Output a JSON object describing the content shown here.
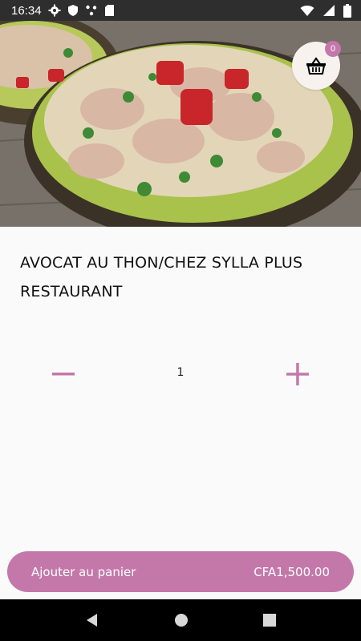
{
  "status": {
    "time": "16:34",
    "left_icons": [
      "gear-icon",
      "shield-icon",
      "dots-icon",
      "sd-card-icon"
    ],
    "right_icons": [
      "wifi-icon",
      "signal-icon",
      "battery-icon"
    ]
  },
  "cart": {
    "count": "0",
    "icon": "basket-icon"
  },
  "product": {
    "title": "AVOCAT AU THON/CHEZ SYLLA PLUS RESTAURANT",
    "image_alt": "avocado stuffed with tuna salad"
  },
  "quantity": {
    "value": "1"
  },
  "add_bar": {
    "label": "Ajouter au panier",
    "price": "CFA1,500.00"
  },
  "colors": {
    "accent": "#c478aa",
    "status_bar": "#2e2e2e",
    "nav_bar": "#000000"
  }
}
